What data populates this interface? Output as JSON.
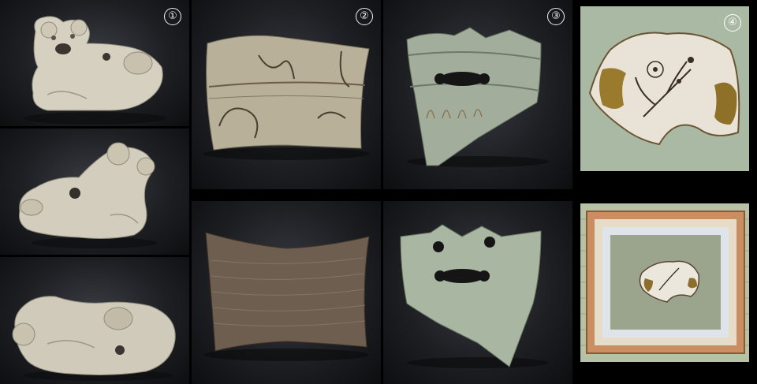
{
  "panels": [
    {
      "id": "figurine-front",
      "number": ""
    },
    {
      "id": "figurine-side",
      "number": ""
    },
    {
      "id": "figurine-top",
      "number": ""
    },
    {
      "id": "sherd-2-top",
      "number": "②"
    },
    {
      "id": "sherd-2-bottom",
      "number": ""
    },
    {
      "id": "sherd-3-top",
      "number": "③"
    },
    {
      "id": "sherd-3-bottom",
      "number": ""
    },
    {
      "id": "plate-4",
      "number": "④"
    },
    {
      "id": "framed-plate",
      "number": ""
    }
  ],
  "labels": {
    "one": "①",
    "two": "②",
    "three": "③",
    "four": "④"
  },
  "colors": {
    "background": "#000000",
    "panel": "#25272b",
    "celadon": "#a9b5a4",
    "cream": "#d8d2c4",
    "tan": "#b8ad94",
    "brown": "#5a4a3a",
    "frame_wood": "#c9926a",
    "tatami": "#a9b8a2"
  }
}
